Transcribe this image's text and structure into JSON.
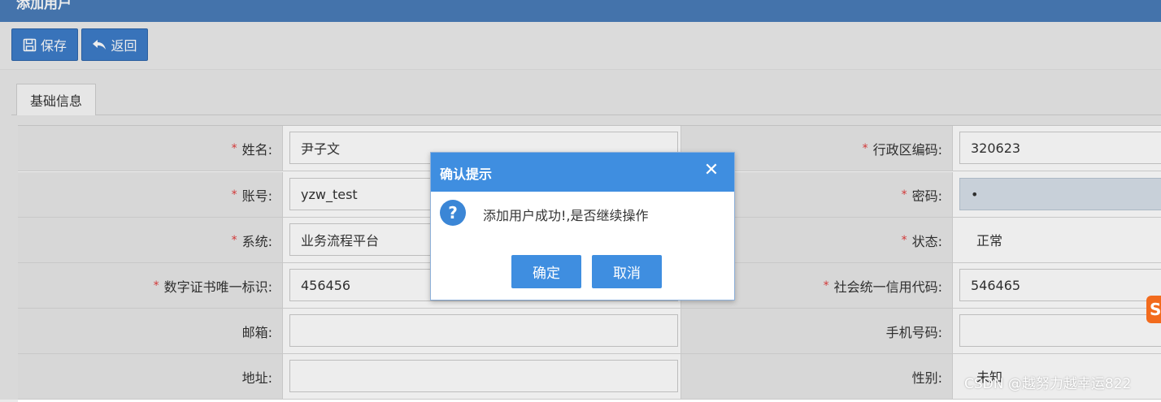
{
  "window": {
    "title": "添加用户"
  },
  "toolbar": {
    "save_label": "保存",
    "back_label": "返回"
  },
  "tabs": [
    {
      "label": "基础信息"
    }
  ],
  "form": {
    "rows": [
      {
        "left": {
          "label": "姓名:",
          "required": true,
          "value": "尹子文"
        },
        "right": {
          "label": "行政区编码:",
          "required": true,
          "value": "320623"
        }
      },
      {
        "left": {
          "label": "账号:",
          "required": true,
          "value": "yzw_test"
        },
        "right": {
          "label": "密码:",
          "required": true,
          "value": "•"
        }
      },
      {
        "left": {
          "label": "系统:",
          "required": true,
          "value": "业务流程平台"
        },
        "right": {
          "label": "状态:",
          "required": true,
          "value": "正常"
        }
      },
      {
        "left": {
          "label": "数字证书唯一标识:",
          "required": true,
          "value": "456456"
        },
        "right": {
          "label": "社会统一信用代码:",
          "required": true,
          "value": "546465"
        }
      },
      {
        "left": {
          "label": "邮箱:",
          "required": false,
          "value": ""
        },
        "right": {
          "label": "手机号码:",
          "required": false,
          "value": ""
        }
      },
      {
        "left": {
          "label": "地址:",
          "required": false,
          "value": ""
        },
        "right": {
          "label": "性别:",
          "required": false,
          "value": "未知"
        }
      }
    ],
    "required_mark": "*"
  },
  "dialog": {
    "title": "确认提示",
    "close_icon": "close-icon",
    "question_icon": "question-icon",
    "message": "添加用户成功!,是否继续操作",
    "ok_label": "确定",
    "cancel_label": "取消"
  },
  "watermark": "CSDN @越努力越幸运822",
  "colors": {
    "header": "#4a7cb8",
    "button": "#3d7cc9",
    "dialog_header": "#3f8ee0",
    "required": "#e23c3c",
    "label_bg": "#e8e8e8"
  }
}
